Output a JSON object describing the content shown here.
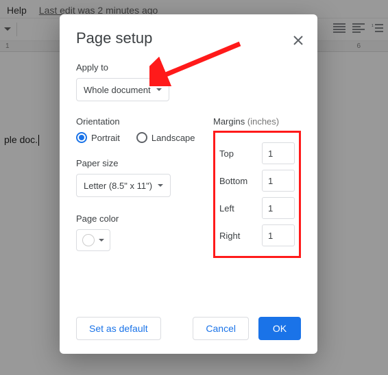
{
  "menubar": {
    "help": "Help",
    "lastedit": "Last edit was 2 minutes ago"
  },
  "ruler": {
    "t1": "1",
    "t6": "6"
  },
  "doc": {
    "visible_text": "ple doc."
  },
  "dialog": {
    "title": "Page setup",
    "apply_to_label": "Apply to",
    "apply_to_value": "Whole document",
    "orientation_label": "Orientation",
    "portrait": "Portrait",
    "landscape": "Landscape",
    "paper_size_label": "Paper size",
    "paper_size_value": "Letter (8.5\" x 11\")",
    "page_color_label": "Page color",
    "margins_label": "Margins",
    "margins_unit": "(inches)",
    "margins": {
      "top_label": "Top",
      "top_value": "1",
      "bottom_label": "Bottom",
      "bottom_value": "1",
      "left_label": "Left",
      "left_value": "1",
      "right_label": "Right",
      "right_value": "1"
    },
    "set_default": "Set as default",
    "cancel": "Cancel",
    "ok": "OK"
  },
  "colors": {
    "primary": "#1a73e8",
    "highlight": "#ff1a1a"
  }
}
